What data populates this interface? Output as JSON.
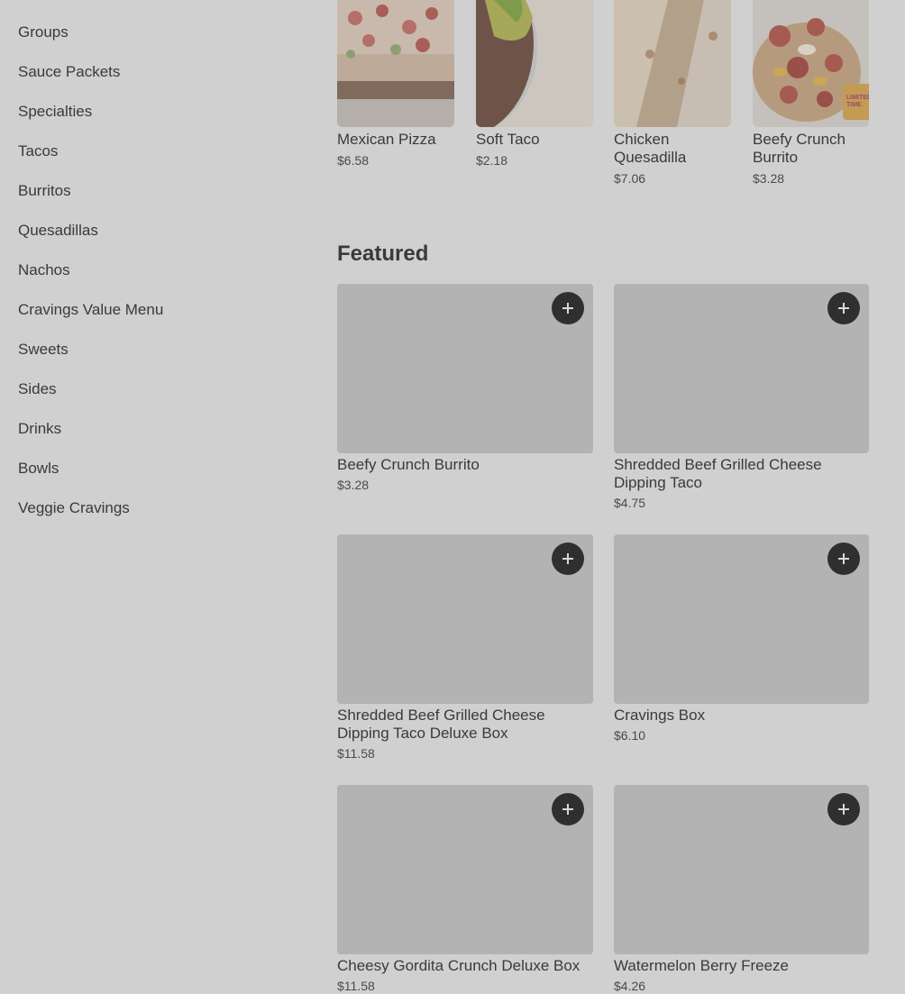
{
  "sidebar": {
    "items": [
      {
        "label": "Groups"
      },
      {
        "label": "Sauce Packets"
      },
      {
        "label": "Specialties"
      },
      {
        "label": "Tacos"
      },
      {
        "label": "Burritos"
      },
      {
        "label": "Quesadillas"
      },
      {
        "label": "Nachos"
      },
      {
        "label": "Cravings Value Menu"
      },
      {
        "label": "Sweets"
      },
      {
        "label": "Sides"
      },
      {
        "label": "Drinks"
      },
      {
        "label": "Bowls"
      },
      {
        "label": "Veggie Cravings"
      }
    ]
  },
  "carousel": {
    "items": [
      {
        "name": "Mexican Pizza",
        "price": "$6.58"
      },
      {
        "name": "Soft Taco",
        "price": "$2.18"
      },
      {
        "name": "Chicken Quesadilla",
        "price": "$7.06"
      },
      {
        "name": "Beefy Crunch Burrito",
        "price": "$3.28",
        "badge": "LIMITED TIME"
      }
    ]
  },
  "featured": {
    "title": "Featured",
    "items": [
      {
        "name": "Beefy Crunch Burrito",
        "price": "$3.28"
      },
      {
        "name": "Shredded Beef Grilled Cheese Dipping Taco",
        "price": "$4.75"
      },
      {
        "name": "Shredded Beef Grilled Cheese Dipping Taco Deluxe Box",
        "price": "$11.58"
      },
      {
        "name": "Cravings Box",
        "price": "$6.10"
      },
      {
        "name": "Cheesy Gordita Crunch Deluxe Box",
        "price": "$11.58"
      },
      {
        "name": "Watermelon Berry Freeze",
        "price": "$4.26"
      }
    ]
  },
  "icons": {
    "add": "plus-icon"
  },
  "colors": {
    "background": "#d0d0d0",
    "placeholder": "#b3b3b3",
    "button": "#2f2f2f",
    "text": "#3a3a3a"
  }
}
